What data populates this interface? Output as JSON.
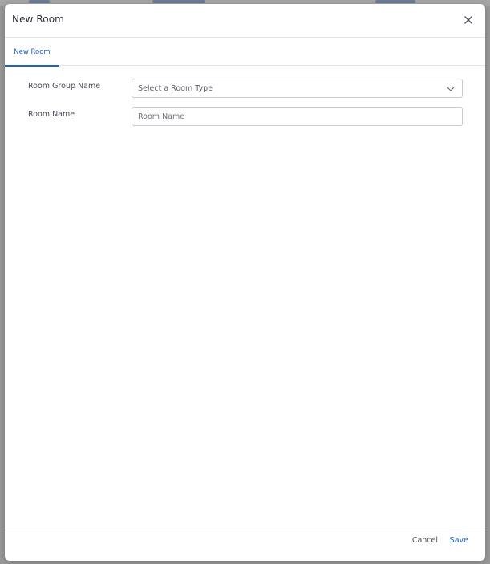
{
  "modal": {
    "title": "New Room",
    "close_icon": "close-icon"
  },
  "tabs": [
    {
      "label": "New Room",
      "active": true
    }
  ],
  "form": {
    "room_group": {
      "label": "Room Group Name",
      "placeholder": "Select a Room Type",
      "icon": "chevron-down-icon"
    },
    "room_name": {
      "label": "Room Name",
      "placeholder": "Room Name",
      "value": ""
    }
  },
  "footer": {
    "cancel_label": "Cancel",
    "save_label": "Save"
  },
  "colors": {
    "accent": "#1f5fbf",
    "overlay": "#9b9b9b",
    "border": "#c9cdd3"
  }
}
